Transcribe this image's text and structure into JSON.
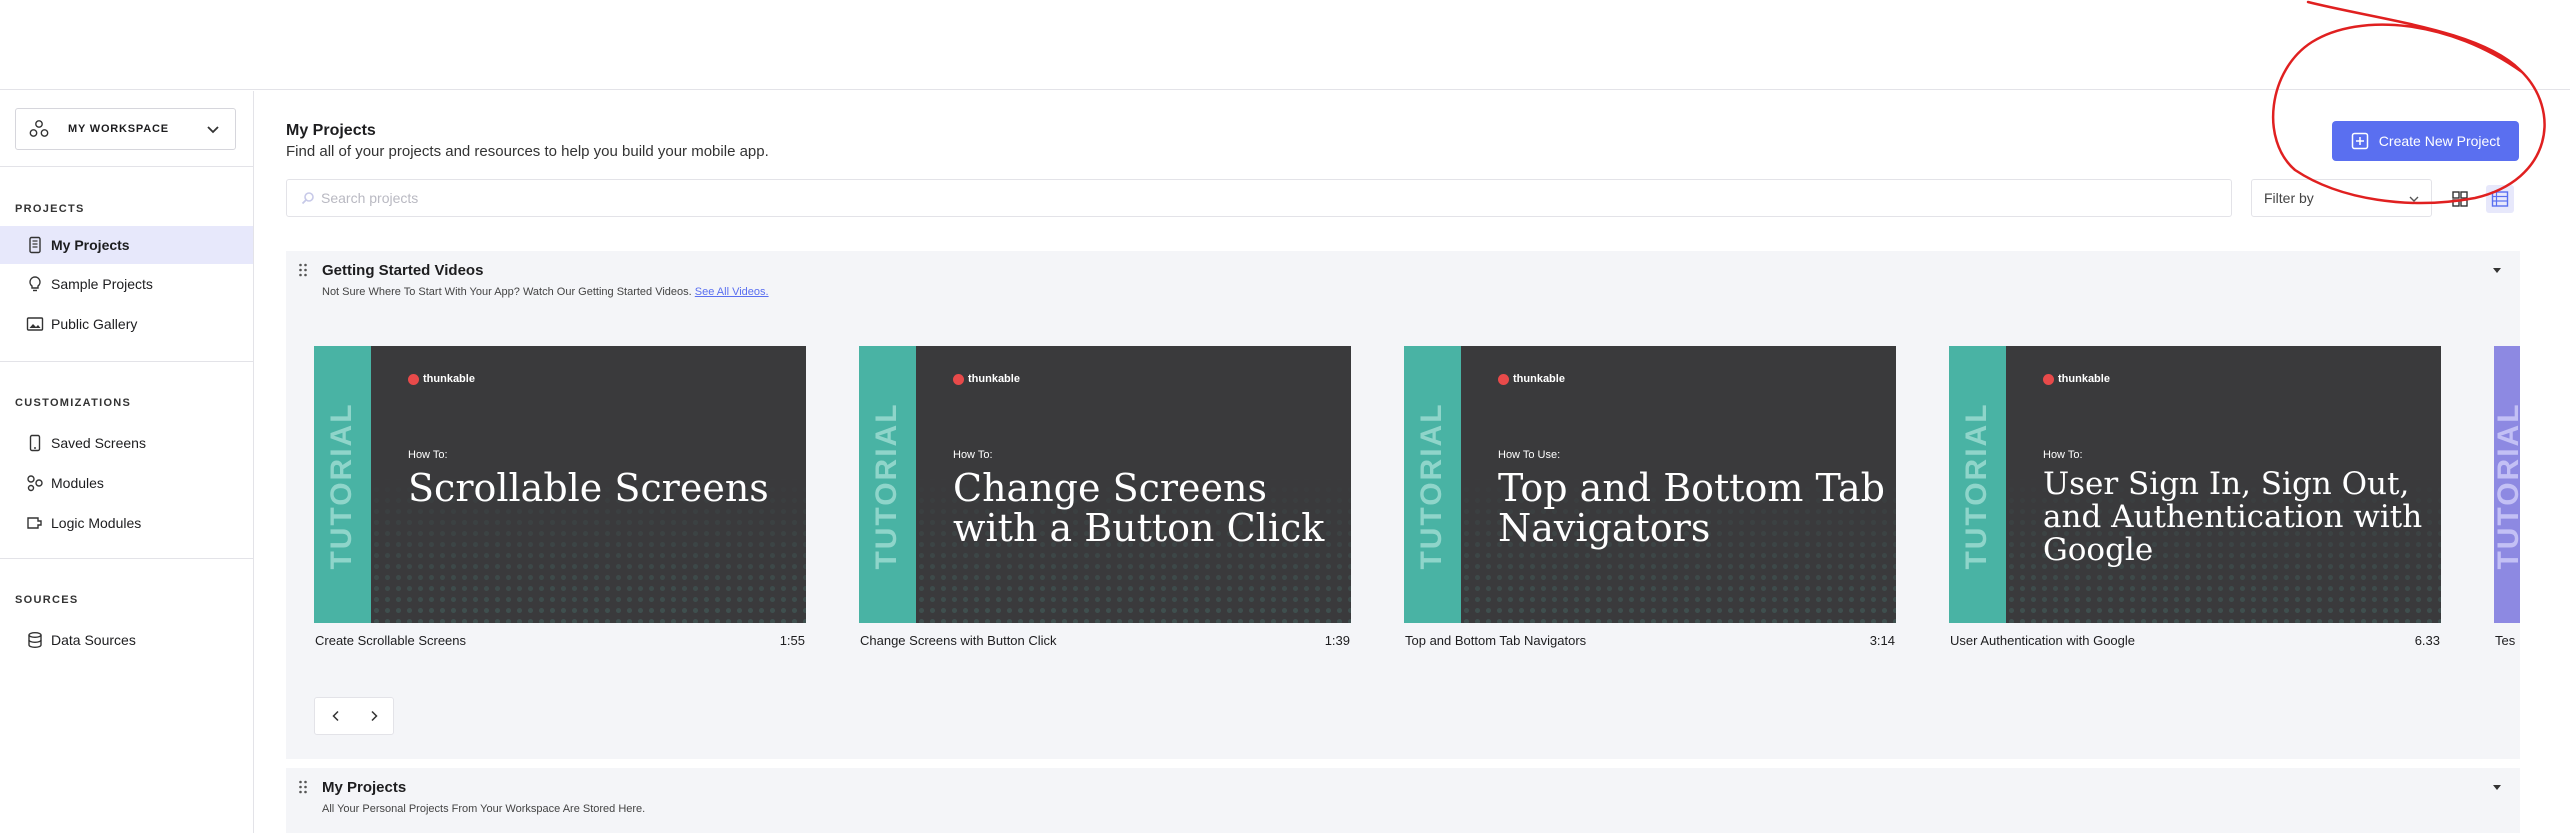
{
  "sidebar": {
    "workspace_label": "MY WORKSPACE",
    "sections": [
      {
        "heading": "PROJECTS",
        "items": [
          "My Projects",
          "Sample Projects",
          "Public Gallery"
        ]
      },
      {
        "heading": "CUSTOMIZATIONS",
        "items": [
          "Saved Screens",
          "Modules",
          "Logic Modules"
        ]
      },
      {
        "heading": "SOURCES",
        "items": [
          "Data Sources"
        ]
      }
    ],
    "active_item": "My Projects"
  },
  "header": {
    "title": "My Projects",
    "subtitle": "Find all of your projects and resources to help you build your mobile app.",
    "create_button": "Create New Project"
  },
  "toolbar": {
    "search_placeholder": "Search projects",
    "filter_label": "Filter by",
    "view_modes": [
      "grid",
      "list"
    ],
    "active_view": "list"
  },
  "getting_started": {
    "title": "Getting Started Videos",
    "subtitle": "Not Sure Where To Start With Your App? Watch Our Getting Started Videos.",
    "link": "See All Videos.",
    "videos": [
      {
        "band": "TUTORIAL",
        "brand": "thunkable",
        "kicker": "How To:",
        "headline": "Scrollable Screens",
        "title": "Create Scrollable Screens",
        "duration": "1:55"
      },
      {
        "band": "TUTORIAL",
        "brand": "thunkable",
        "kicker": "How To:",
        "headline": "Change Screens with a Button Click",
        "title": "Change Screens with Button Click",
        "duration": "1:39"
      },
      {
        "band": "TUTORIAL",
        "brand": "thunkable",
        "kicker": "How To Use:",
        "headline": "Top and Bottom Tab Navigators",
        "title": "Top and Bottom Tab Navigators",
        "duration": "3:14"
      },
      {
        "band": "TUTORIAL",
        "brand": "thunkable",
        "kicker": "How To:",
        "headline": "User Sign In, Sign Out, and Authentication with Google",
        "title": "User Authentication with Google",
        "duration": "6.33"
      },
      {
        "band": "TUTORIAL",
        "title": "Tes"
      }
    ]
  },
  "my_projects_section": {
    "title": "My Projects",
    "subtitle": "All Your Personal Projects From Your Workspace Are Stored Here."
  },
  "colors": {
    "accent": "#5a6ff0",
    "active_bg": "#e7e8fb",
    "tutorial_band": "#49b3a4",
    "annotation": "#e02020"
  }
}
